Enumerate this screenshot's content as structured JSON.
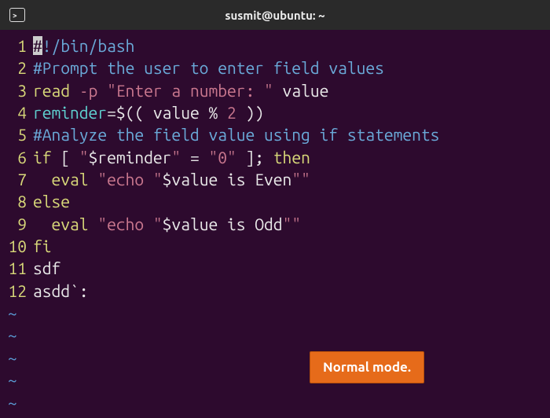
{
  "titlebar": {
    "title": "susmit@ubuntu: ~"
  },
  "lines": [
    {
      "no": "1",
      "tokens": [
        {
          "cls": "cursor",
          "t": "#"
        },
        {
          "cls": "comment",
          "t": "!/bin/bash"
        }
      ]
    },
    {
      "no": "2",
      "tokens": [
        {
          "cls": "comment",
          "t": "#Prompt the user to enter field values"
        }
      ]
    },
    {
      "no": "3",
      "tokens": [
        {
          "cls": "keyword",
          "t": "read"
        },
        {
          "cls": "",
          "t": " "
        },
        {
          "cls": "string",
          "t": "-p"
        },
        {
          "cls": "",
          "t": " "
        },
        {
          "cls": "string",
          "t": "\"Enter a number: \""
        },
        {
          "cls": "",
          "t": " value"
        }
      ]
    },
    {
      "no": "4",
      "tokens": [
        {
          "cls": "variable",
          "t": "reminder"
        },
        {
          "cls": "",
          "t": "="
        },
        {
          "cls": "special",
          "t": "$("
        },
        {
          "cls": "",
          "t": "( value % "
        },
        {
          "cls": "number",
          "t": "2"
        },
        {
          "cls": "",
          "t": " )"
        },
        {
          "cls": "special",
          "t": ")"
        }
      ]
    },
    {
      "no": "5",
      "tokens": [
        {
          "cls": "comment",
          "t": "#Analyze the field value using if statements"
        }
      ]
    },
    {
      "no": "6",
      "tokens": [
        {
          "cls": "keyword",
          "t": "if"
        },
        {
          "cls": "",
          "t": " [ "
        },
        {
          "cls": "string",
          "t": "\""
        },
        {
          "cls": "special",
          "t": "$reminder"
        },
        {
          "cls": "string",
          "t": "\""
        },
        {
          "cls": "",
          "t": " = "
        },
        {
          "cls": "string",
          "t": "\"0\""
        },
        {
          "cls": "",
          "t": " ]; "
        },
        {
          "cls": "keyword",
          "t": "then"
        }
      ]
    },
    {
      "no": "7",
      "tokens": [
        {
          "cls": "",
          "t": "  "
        },
        {
          "cls": "keyword",
          "t": "eval"
        },
        {
          "cls": "",
          "t": " "
        },
        {
          "cls": "string",
          "t": "\"echo \""
        },
        {
          "cls": "special",
          "t": "$value"
        },
        {
          "cls": "",
          "t": " is Even"
        },
        {
          "cls": "string",
          "t": "\"\""
        }
      ]
    },
    {
      "no": "8",
      "tokens": [
        {
          "cls": "keyword",
          "t": "else"
        }
      ]
    },
    {
      "no": "9",
      "tokens": [
        {
          "cls": "",
          "t": "  "
        },
        {
          "cls": "keyword",
          "t": "eval"
        },
        {
          "cls": "",
          "t": " "
        },
        {
          "cls": "string",
          "t": "\"echo \""
        },
        {
          "cls": "special",
          "t": "$value"
        },
        {
          "cls": "",
          "t": " is Odd"
        },
        {
          "cls": "string",
          "t": "\"\""
        }
      ]
    },
    {
      "no": "10",
      "tokens": [
        {
          "cls": "keyword",
          "t": "fi"
        }
      ]
    },
    {
      "no": "11",
      "tokens": [
        {
          "cls": "",
          "t": "sdf"
        }
      ]
    },
    {
      "no": "12",
      "tokens": [
        {
          "cls": "",
          "t": "asdd`:"
        }
      ]
    }
  ],
  "tildes": [
    "~",
    "~",
    "~",
    "~",
    "~"
  ],
  "badge": {
    "text": "Normal mode."
  }
}
